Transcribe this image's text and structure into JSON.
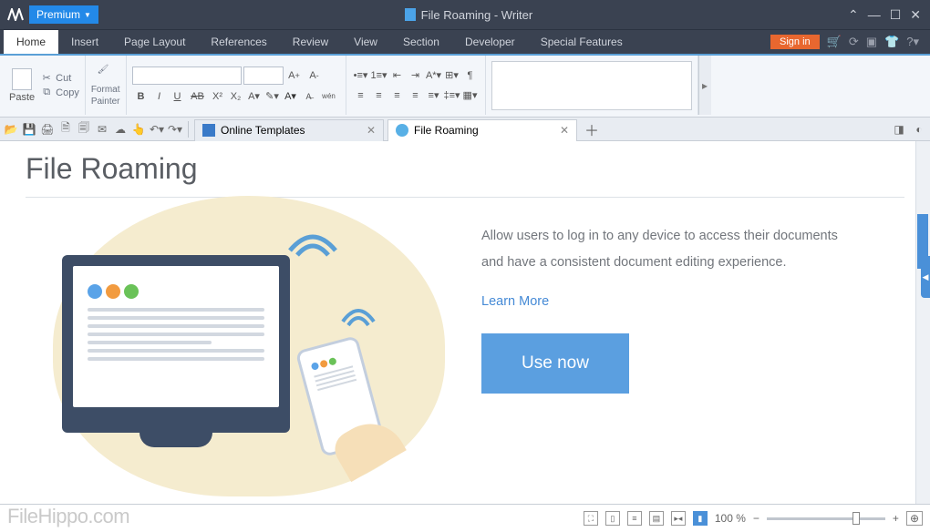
{
  "titlebar": {
    "premium": "Premium",
    "doc_title": "File Roaming - Writer"
  },
  "menu": {
    "items": [
      "Home",
      "Insert",
      "Page Layout",
      "References",
      "Review",
      "View",
      "Section",
      "Developer",
      "Special Features"
    ],
    "signin": "Sign in"
  },
  "ribbon": {
    "paste": "Paste",
    "cut": "Cut",
    "copy": "Copy",
    "format_painter_l1": "Format",
    "format_painter_l2": "Painter",
    "bold": "B",
    "italic": "I",
    "underline": "U",
    "strike": "AB",
    "supers": "X²",
    "subs": "X₂",
    "aa_inc": "A",
    "aa_dec": "A",
    "wen": "wén"
  },
  "qat": {
    "tab1": "Online Templates",
    "tab2": "File Roaming"
  },
  "content": {
    "title": "File Roaming",
    "desc": "Allow users to log in to any device to access their documents and have a consistent document editing experience.",
    "learn_more": "Learn More",
    "use_now": "Use now"
  },
  "status": {
    "zoom": "100 %",
    "watermark": "FileHippo.com"
  }
}
